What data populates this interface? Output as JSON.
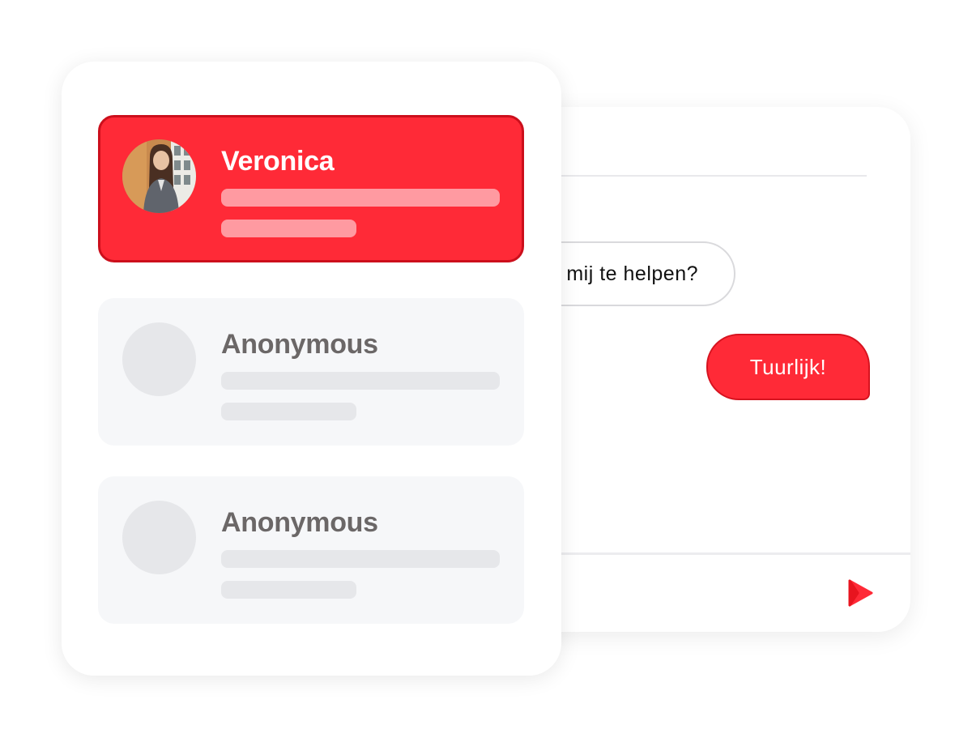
{
  "chat": {
    "incoming_message": "mij te helpen?",
    "outgoing_message": "Tuurlijk!",
    "send_icon": "send-arrow-icon"
  },
  "conversations": [
    {
      "name": "Veronica",
      "active": true,
      "avatar": "photo"
    },
    {
      "name": "Anonymous",
      "active": false,
      "avatar": "placeholder"
    },
    {
      "name": "Anonymous",
      "active": false,
      "avatar": "placeholder"
    }
  ],
  "colors": {
    "accent": "#ff2a37",
    "accent_border": "#cc0f1c",
    "active_preview": "#ff9aa1",
    "inactive_card": "#f6f7f9",
    "placeholder": "#e6e7ea",
    "inactive_name": "#6b6767"
  }
}
